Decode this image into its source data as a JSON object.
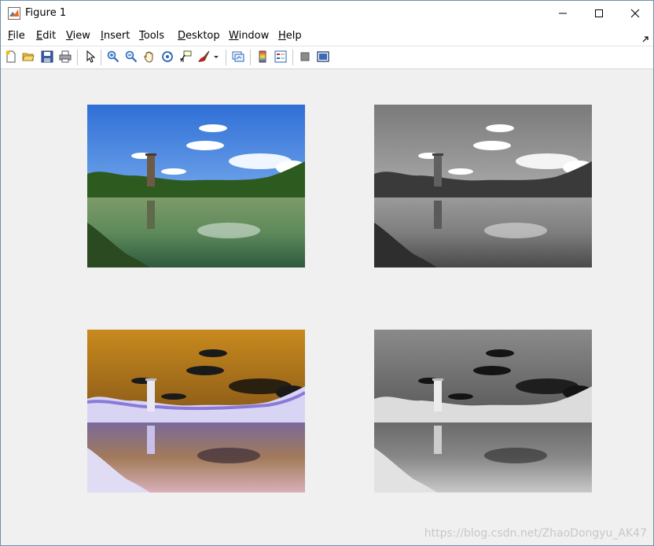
{
  "window": {
    "title": "Figure 1",
    "controls": [
      "minimize",
      "maximize",
      "close"
    ]
  },
  "menu": {
    "items": [
      {
        "pre": "",
        "u": "F",
        "post": "ile"
      },
      {
        "pre": "",
        "u": "E",
        "post": "dit"
      },
      {
        "pre": "",
        "u": "V",
        "post": "iew"
      },
      {
        "pre": "",
        "u": "I",
        "post": "nsert"
      },
      {
        "pre": "",
        "u": "T",
        "post": "ools"
      },
      {
        "pre": "",
        "u": "D",
        "post": "esktop"
      },
      {
        "pre": "",
        "u": "W",
        "post": "indow"
      },
      {
        "pre": "",
        "u": "H",
        "post": "elp"
      }
    ]
  },
  "toolbar": {
    "icons": [
      "new-figure-icon",
      "open-file-icon",
      "save-icon",
      "print-icon",
      "edit-plot-arrow-icon",
      "zoom-in-icon",
      "zoom-out-icon",
      "pan-hand-icon",
      "rotate-3d-icon",
      "data-cursor-icon",
      "brush-icon",
      "brush-dropdown-icon",
      "link-plot-icon",
      "colorbar-icon",
      "legend-icon",
      "hide-plot-tools-icon",
      "show-plot-tools-icon"
    ]
  },
  "figure": {
    "subplots": [
      {
        "name": "original-color-image",
        "variant": "color"
      },
      {
        "name": "grayscale-image",
        "variant": "gray"
      },
      {
        "name": "inverted-color-image",
        "variant": "invcolor"
      },
      {
        "name": "inverted-grayscale-image",
        "variant": "invgray"
      }
    ]
  },
  "watermark": "https://blog.csdn.net/ZhaoDongyu_AK47"
}
